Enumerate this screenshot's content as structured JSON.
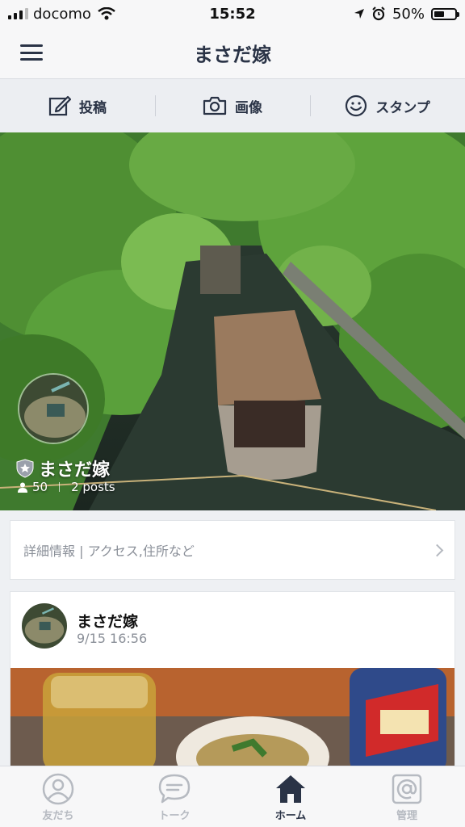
{
  "status_bar": {
    "carrier": "docomo",
    "time": "15:52",
    "battery": "50%",
    "battery_level": 0.5
  },
  "header": {
    "title": "まさだ嫁"
  },
  "actions": [
    {
      "label": "投稿",
      "icon": "compose-icon"
    },
    {
      "label": "画像",
      "icon": "camera-icon"
    },
    {
      "label": "スタンプ",
      "icon": "smiley-icon"
    }
  ],
  "profile": {
    "name": "まさだ嫁",
    "followers": "50",
    "posts": "2 posts"
  },
  "info": {
    "text": "詳細情報 | アクセス,住所など"
  },
  "post": {
    "author": "まさだ嫁",
    "time": "9/15 16:56"
  },
  "tabs": [
    {
      "label": "友だち",
      "icon": "person-icon",
      "active": false
    },
    {
      "label": "トーク",
      "icon": "chat-icon",
      "active": false
    },
    {
      "label": "ホーム",
      "icon": "home-icon",
      "active": true
    },
    {
      "label": "管理",
      "icon": "at-sign-icon",
      "active": false
    }
  ],
  "colors": {
    "accent": "#2a3346",
    "inactive": "#b6bac1",
    "background": "#eef0f3"
  }
}
